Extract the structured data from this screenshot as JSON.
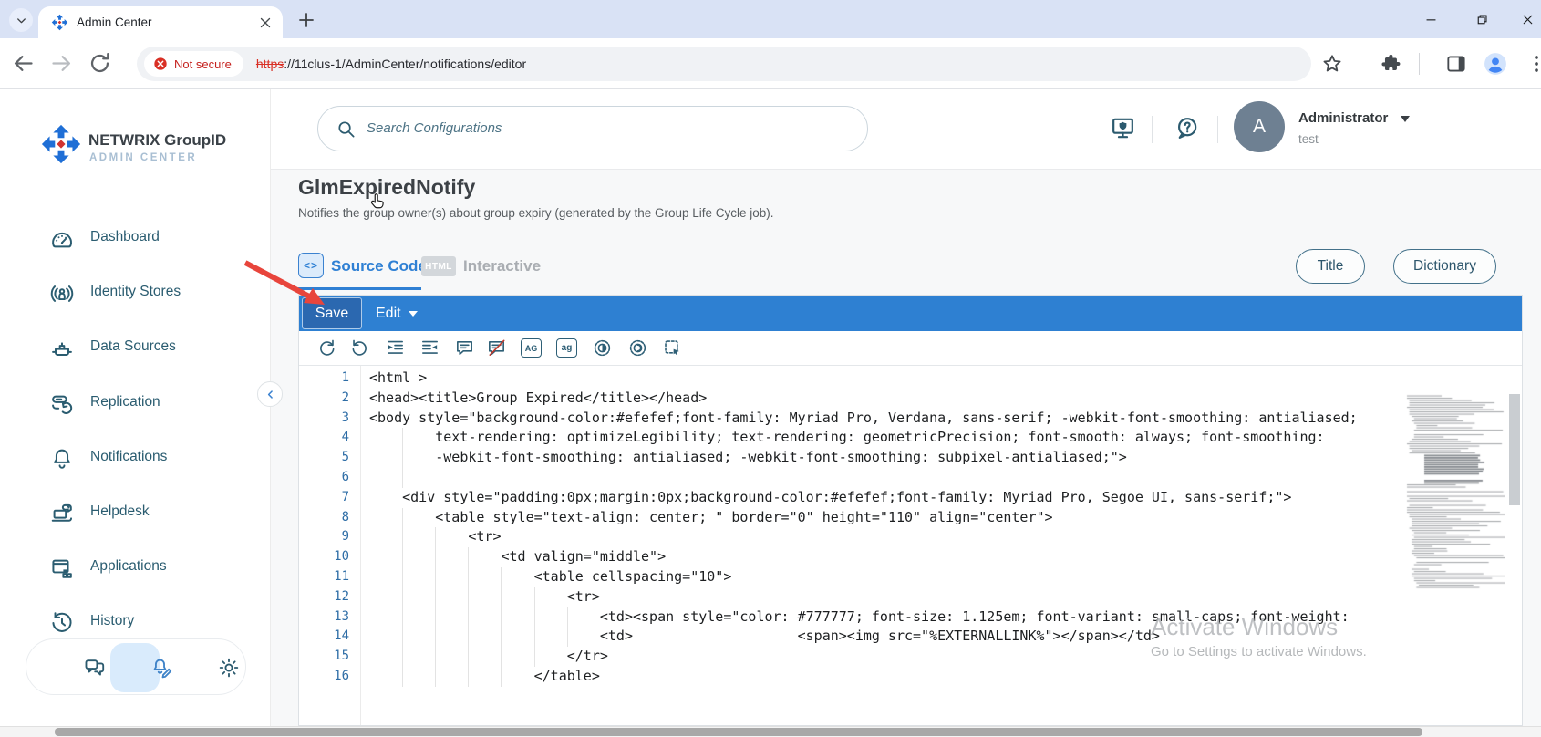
{
  "browser": {
    "tab_title": "Admin Center",
    "security_label": "Not secure",
    "url_scheme": "https",
    "url_rest": "://11clus-1/AdminCenter/notifications/editor"
  },
  "brand": {
    "name": "NETWRIX GroupID",
    "subtitle": "ADMIN CENTER"
  },
  "header": {
    "search_placeholder": "Search Configurations",
    "user_name": "Administrator",
    "user_context": "test",
    "avatar_letter": "A"
  },
  "sidebar": {
    "items": [
      {
        "icon": "dashboard",
        "label": "Dashboard"
      },
      {
        "icon": "identity-stores",
        "label": "Identity Stores"
      },
      {
        "icon": "data-sources",
        "label": "Data Sources"
      },
      {
        "icon": "replication",
        "label": "Replication"
      },
      {
        "icon": "notifications",
        "label": "Notifications"
      },
      {
        "icon": "helpdesk",
        "label": "Helpdesk"
      },
      {
        "icon": "applications",
        "label": "Applications"
      },
      {
        "icon": "history",
        "label": "History"
      }
    ],
    "footer_icons": [
      {
        "icon": "feedback",
        "active": false
      },
      {
        "icon": "notification-edit",
        "active": true
      },
      {
        "icon": "settings",
        "active": false
      }
    ]
  },
  "page": {
    "title": "GlmExpiredNotify",
    "description": "Notifies the group owner(s) about group expiry (generated by the Group Life Cycle job).",
    "tabs": [
      {
        "label": "Source Code",
        "active": true,
        "icon_glyph": "<>"
      },
      {
        "label": "Interactive",
        "active": false,
        "badge": "HTML"
      }
    ],
    "buttons": {
      "title": "Title",
      "dictionary": "Dictionary"
    }
  },
  "editor": {
    "save_label": "Save",
    "edit_label": "Edit",
    "toolbar_icons": [
      "redo",
      "undo",
      "indent",
      "outdent",
      "comment",
      "uncomment",
      "uppercase",
      "lowercase",
      "contrast-dark",
      "contrast-light",
      "select-block"
    ],
    "toolbar_badges": {
      "uppercase": "AG",
      "lowercase": "ag"
    },
    "lines": [
      "<html >",
      "<head><title>Group Expired</title></head>",
      "<body style=\"background-color:#efefef;font-family: Myriad Pro, Verdana, sans-serif; -webkit-font-smoothing: antialiased;",
      "        text-rendering: optimizeLegibility; text-rendering: geometricPrecision; font-smooth: always; font-smoothing:",
      "        -webkit-font-smoothing: antialiased; -webkit-font-smoothing: subpixel-antialiased;\">",
      "",
      "    <div style=\"padding:0px;margin:0px;background-color:#efefef;font-family: Myriad Pro, Segoe UI, sans-serif;\">",
      "        <table style=\"text-align: center; \" border=\"0\" height=\"110\" align=\"center\">",
      "            <tr>",
      "                <td valign=\"middle\">",
      "                    <table cellspacing=\"10\">",
      "                        <tr>",
      "                            <td><span style=\"color: #777777; font-size: 1.125em; font-variant: small-caps; font-weight:",
      "                            <td>                    <span><img src=\"%EXTERNALLINK%\"></span></td>",
      "                        </tr>",
      "                    </table>"
    ]
  },
  "watermark": {
    "line1": "Activate Windows",
    "line2": "Go to Settings to activate Windows."
  },
  "colors": {
    "accent_blue": "#2e80d2",
    "sidebar_teal": "#2a5c70",
    "annotation_red": "#e8453c",
    "not_secure_red": "#c5221f"
  }
}
